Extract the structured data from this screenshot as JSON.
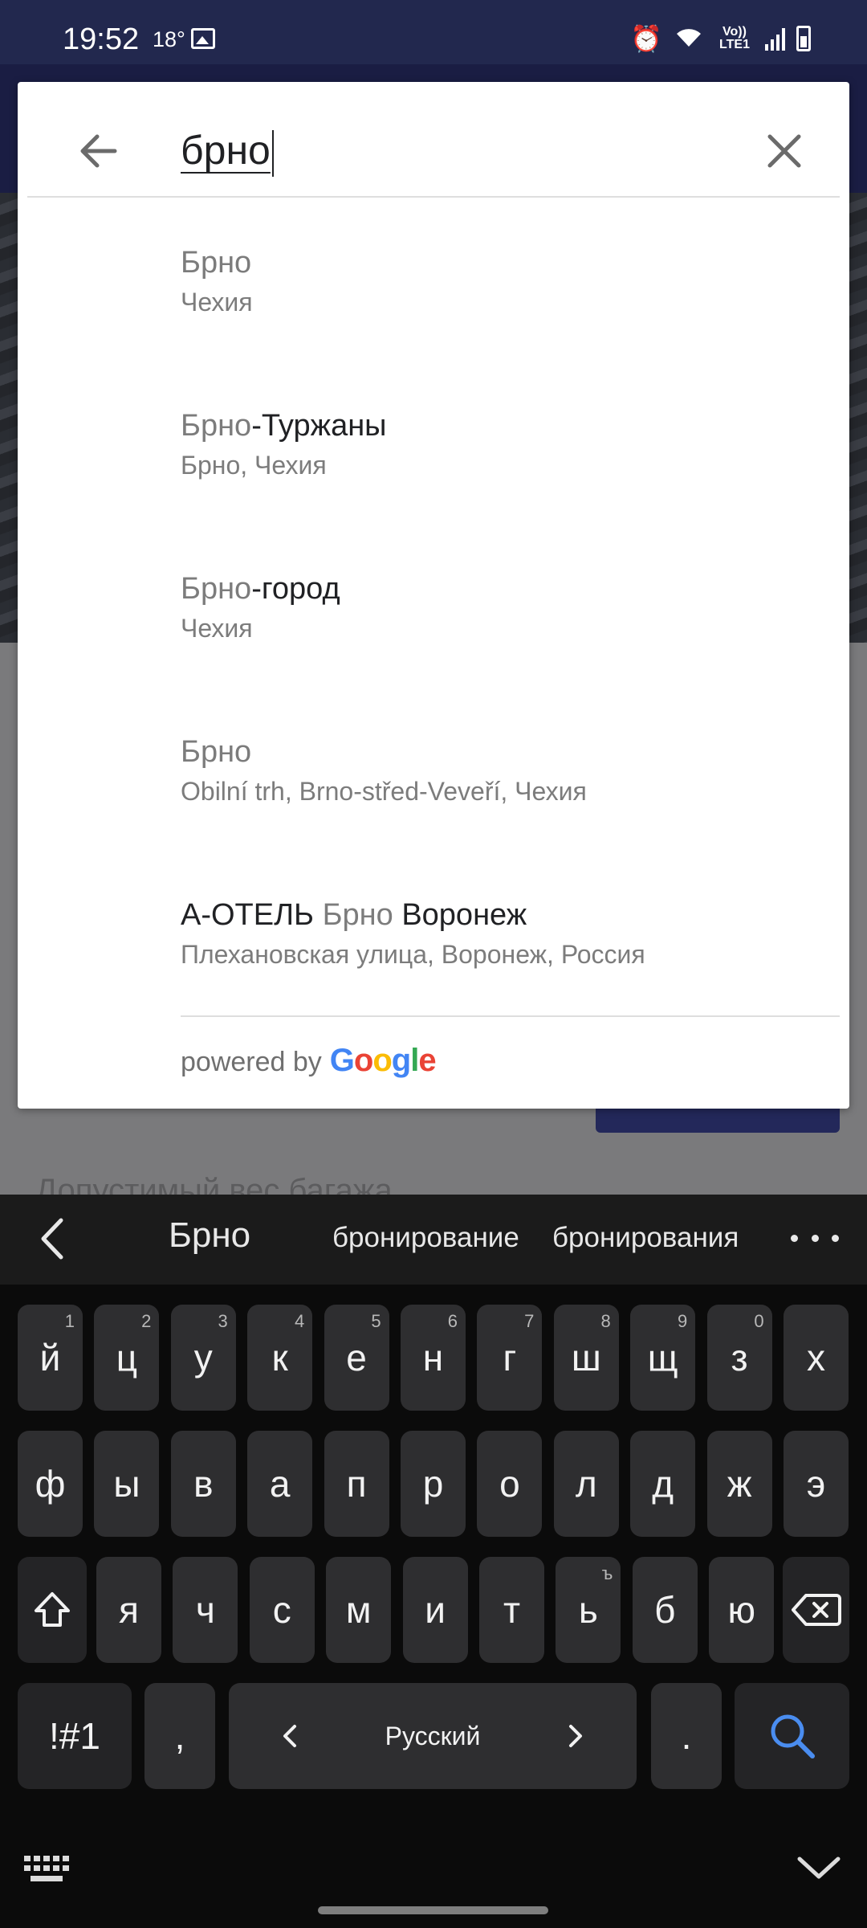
{
  "status_bar": {
    "time": "19:52",
    "temperature": "18°",
    "network_label": "Vo)) LTE1"
  },
  "search": {
    "query": "брно",
    "back_icon": "arrow-left-icon",
    "clear_icon": "close-icon"
  },
  "results": [
    {
      "parts": [
        {
          "text": "Брно",
          "match": true
        }
      ],
      "secondary": "Чехия"
    },
    {
      "parts": [
        {
          "text": "Брно",
          "match": true
        },
        {
          "text": "-Туржаны",
          "match": false
        }
      ],
      "secondary": "Брно, Чехия"
    },
    {
      "parts": [
        {
          "text": "Брно",
          "match": true
        },
        {
          "text": "-город",
          "match": false
        }
      ],
      "secondary": "Чехия"
    },
    {
      "parts": [
        {
          "text": "Брно",
          "match": true
        }
      ],
      "secondary": "Obilní trh, Brno-střed-Veveří, Чехия"
    },
    {
      "parts": [
        {
          "text": "А-ОТЕЛЬ ",
          "match": false
        },
        {
          "text": "Брно",
          "match": true
        },
        {
          "text": " Воронеж",
          "match": false
        }
      ],
      "secondary": "Плехановская улица, Воронеж, Россия"
    }
  ],
  "attribution": {
    "prefix": "powered by",
    "logo_letters": [
      {
        "ch": "G",
        "color": "#4285F4"
      },
      {
        "ch": "o",
        "color": "#EA4335"
      },
      {
        "ch": "o",
        "color": "#FBBC05"
      },
      {
        "ch": "g",
        "color": "#4285F4"
      },
      {
        "ch": "l",
        "color": "#34A853"
      },
      {
        "ch": "e",
        "color": "#EA4335"
      }
    ]
  },
  "background": {
    "partial_text": "Допустимый вес багажа"
  },
  "keyboard": {
    "suggestions": [
      "Брно",
      "бронирование",
      "бронирования"
    ],
    "row1": [
      {
        "ch": "й",
        "hint": "1"
      },
      {
        "ch": "ц",
        "hint": "2"
      },
      {
        "ch": "у",
        "hint": "3"
      },
      {
        "ch": "к",
        "hint": "4"
      },
      {
        "ch": "е",
        "hint": "5"
      },
      {
        "ch": "н",
        "hint": "6"
      },
      {
        "ch": "г",
        "hint": "7"
      },
      {
        "ch": "ш",
        "hint": "8"
      },
      {
        "ch": "щ",
        "hint": "9"
      },
      {
        "ch": "з",
        "hint": "0"
      },
      {
        "ch": "х",
        "hint": ""
      }
    ],
    "row2": [
      {
        "ch": "ф"
      },
      {
        "ch": "ы"
      },
      {
        "ch": "в"
      },
      {
        "ch": "а"
      },
      {
        "ch": "п"
      },
      {
        "ch": "р"
      },
      {
        "ch": "о"
      },
      {
        "ch": "л"
      },
      {
        "ch": "д"
      },
      {
        "ch": "ж"
      },
      {
        "ch": "э"
      }
    ],
    "row3": [
      {
        "ch": "я",
        "hint": ""
      },
      {
        "ch": "ч",
        "hint": ""
      },
      {
        "ch": "с",
        "hint": ""
      },
      {
        "ch": "м",
        "hint": ""
      },
      {
        "ch": "и",
        "hint": ""
      },
      {
        "ch": "т",
        "hint": ""
      },
      {
        "ch": "ь",
        "hint": "ъ"
      },
      {
        "ch": "б",
        "hint": ""
      },
      {
        "ch": "ю",
        "hint": ""
      }
    ],
    "symbols_label": "!#1",
    "comma": ",",
    "space_label": "Русский",
    "period": ".",
    "accent_color": "#4a8df0"
  }
}
